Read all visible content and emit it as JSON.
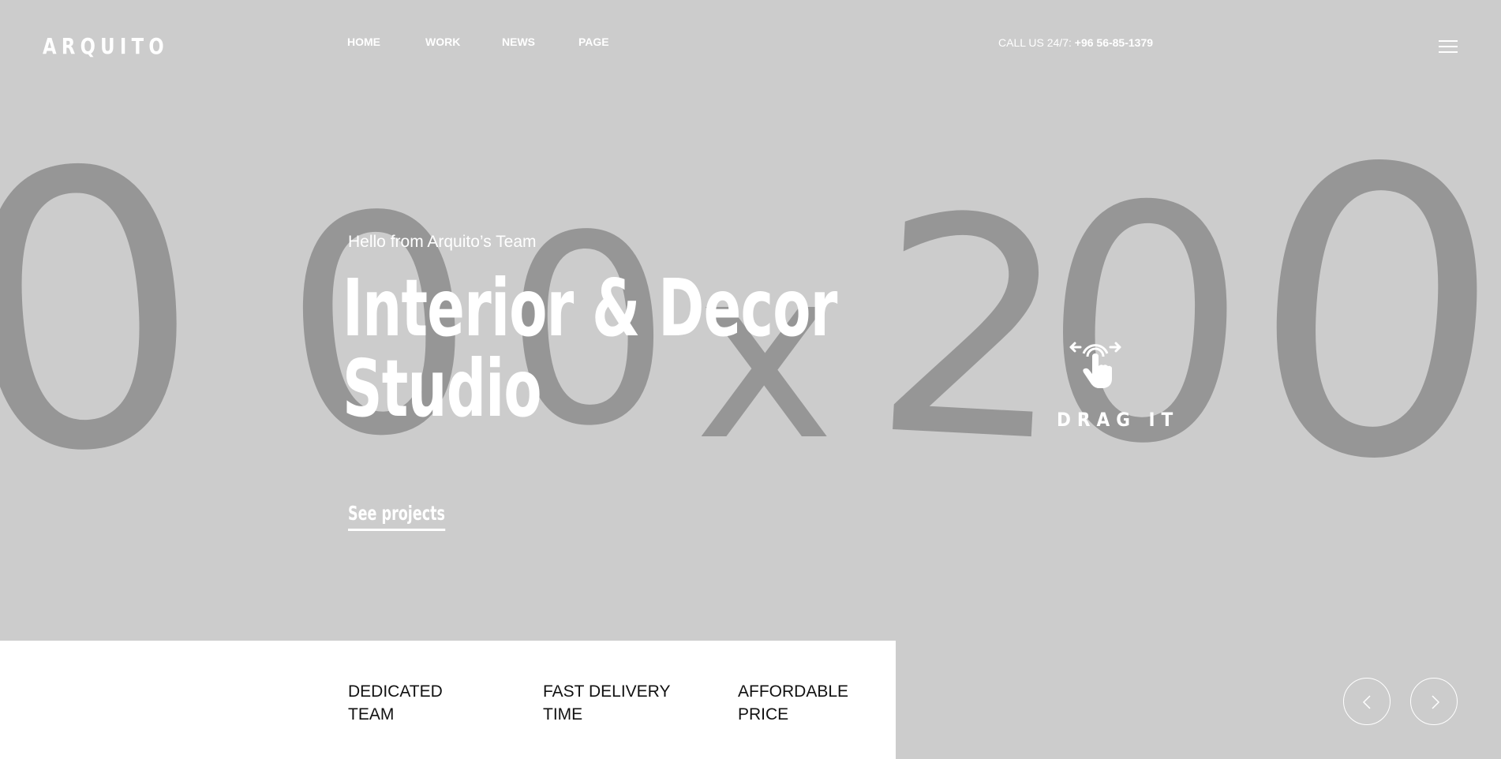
{
  "header": {
    "logo": "ARQUITO",
    "nav": [
      "HOME",
      "WORK",
      "NEWS",
      "PAGE"
    ],
    "phone_prefix": "CALL US 24/7:",
    "phone_number": "+96 56-85-1379"
  },
  "hero": {
    "placeholder_text": "000 x 200",
    "subtitle": "Hello from Arquito’s Team",
    "title_line1": "Interior & Decor",
    "title_line2": "Studio",
    "cta": "See projects",
    "drag_label": "DRAG IT"
  },
  "features": {
    "items": [
      {
        "line1": "DEDICATED",
        "line2": "TEAM"
      },
      {
        "line1": "FAST DELIVERY",
        "line2": "TIME"
      },
      {
        "line1": "AFFORDABLE",
        "line2": "PRICE"
      }
    ]
  },
  "icons": {
    "menu": "hamburger-icon",
    "drag": "drag-hand-icon",
    "prev": "chevron-left-icon",
    "next": "chevron-right-icon"
  },
  "colors": {
    "background": "#cccccc",
    "placeholder_text": "#969696",
    "text_light": "#ffffff",
    "text_dark": "#111111",
    "panel": "#ffffff"
  }
}
